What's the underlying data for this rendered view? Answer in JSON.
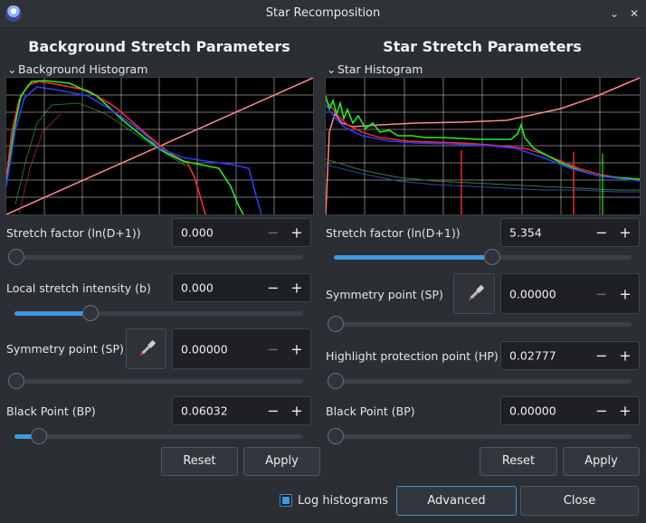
{
  "window": {
    "title": "Star Recomposition"
  },
  "left": {
    "section_title": "Background Stretch Parameters",
    "histogram_label": "Background Histogram",
    "stretch_factor": {
      "label": "Stretch factor (ln(D+1))",
      "value": "0.000",
      "slider": 0.0
    },
    "local_intensity": {
      "label": "Local stretch intensity (b)",
      "value": "0.000",
      "slider": 0.25
    },
    "symmetry_point": {
      "label": "Symmetry point (SP)",
      "value": "0.00000",
      "slider": 0.0
    },
    "black_point": {
      "label": "Black Point (BP)",
      "value": "0.06032",
      "slider": 0.06
    },
    "reset_label": "Reset",
    "apply_label": "Apply"
  },
  "right": {
    "section_title": "Star Stretch Parameters",
    "histogram_label": "Star Histogram",
    "stretch_factor": {
      "label": "Stretch factor (ln(D+1))",
      "value": "5.354",
      "slider": 0.535
    },
    "symmetry_point": {
      "label": "Symmetry point (SP)",
      "value": "0.00000",
      "slider": 0.0
    },
    "highlight_protection": {
      "label": "Highlight protection point (HP)",
      "value": "0.02777",
      "slider": 0.0
    },
    "black_point": {
      "label": "Black Point (BP)",
      "value": "0.00000",
      "slider": 0.0
    },
    "reset_label": "Reset",
    "apply_label": "Apply"
  },
  "footer": {
    "log_histograms_label": "Log histograms",
    "log_histograms_checked": true,
    "advanced_label": "Advanced",
    "close_label": "Close"
  },
  "icons": {
    "minus": "−",
    "plus": "+",
    "chevron": "⌄",
    "minimize": "⌄",
    "close": "✕"
  },
  "colors": {
    "accent": "#3d9ae0",
    "background": "#2b2e33",
    "histogram_red": "#ff2a2a",
    "histogram_green": "#22ee22",
    "histogram_blue": "#2a3cff",
    "curve": "#ff8a8a"
  }
}
